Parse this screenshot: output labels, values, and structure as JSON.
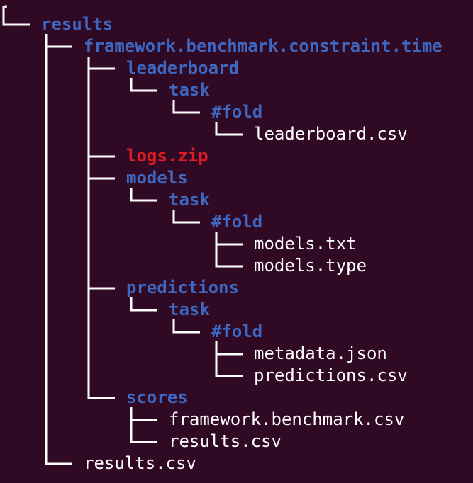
{
  "terminal": {
    "background": "#300a24",
    "colors": {
      "directory": "#3e67c1",
      "file": "#ffffff",
      "archive": "#e01b24"
    },
    "tree": {
      "root": ".",
      "results": "results",
      "framework_dir": "framework.benchmark.constraint.time",
      "leaderboard": "leaderboard",
      "leaderboard_task": "task",
      "leaderboard_fold": "#fold",
      "leaderboard_csv": "leaderboard.csv",
      "logs_zip": "logs.zip",
      "models": "models",
      "models_task": "task",
      "models_fold": "#fold",
      "models_txt": "models.txt",
      "models_type": "models.type",
      "predictions": "predictions",
      "predictions_task": "task",
      "predictions_fold": "#fold",
      "metadata_json": "metadata.json",
      "predictions_csv": "predictions.csv",
      "scores": "scores",
      "framework_csv": "framework.benchmark.csv",
      "scores_results_csv": "results.csv",
      "top_results_csv": "results.csv"
    }
  }
}
